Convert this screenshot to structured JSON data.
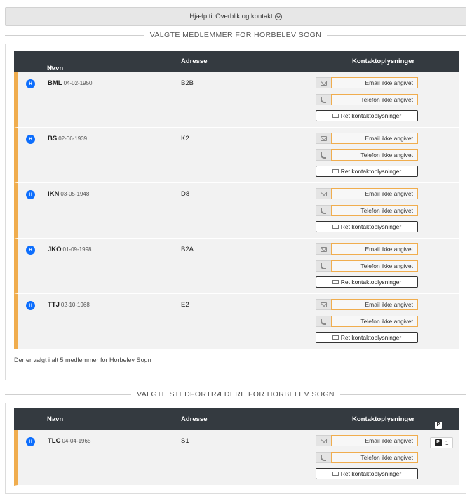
{
  "help": {
    "label": "Hjælp til Overblik og kontakt"
  },
  "members_section": {
    "title": "VALGTE MEDLEMMER FOR HORBELEV SOGN",
    "headers": {
      "name": "Navn",
      "name_sort": "↓ᵃ",
      "address": "Adresse",
      "contact": "Kontaktoplysninger"
    },
    "rows": [
      {
        "badge": "H",
        "initials": "BML",
        "date": "04-02-1950",
        "address": "B2B"
      },
      {
        "badge": "H",
        "initials": "BS",
        "date": "02-06-1939",
        "address": "K2"
      },
      {
        "badge": "H",
        "initials": "IKN",
        "date": "03-05-1948",
        "address": "D8"
      },
      {
        "badge": "H",
        "initials": "JKO",
        "date": "01-09-1998",
        "address": "B2A"
      },
      {
        "badge": "H",
        "initials": "TTJ",
        "date": "02-10-1968",
        "address": "E2"
      }
    ],
    "footer": "Der er valgt i alt 5 medlemmer for Horbelev Sogn"
  },
  "contact_labels": {
    "email": "Email ikke angivet",
    "phone": "Telefon ikke angivet",
    "edit": "Ret kontaktoplysninger"
  },
  "substitutes_section": {
    "title": "VALGTE STEDFORTRÆDERE FOR HORBELEV SOGN",
    "headers": {
      "name": "Navn",
      "address": "Adresse",
      "contact": "Kontaktoplysninger",
      "p_icon": "P",
      "p_sort": "↓↑"
    },
    "rows": [
      {
        "badge": "H",
        "initials": "TLC",
        "date": "04-04-1965",
        "address": "S1",
        "p_label": "P",
        "p_count": "1"
      }
    ]
  }
}
